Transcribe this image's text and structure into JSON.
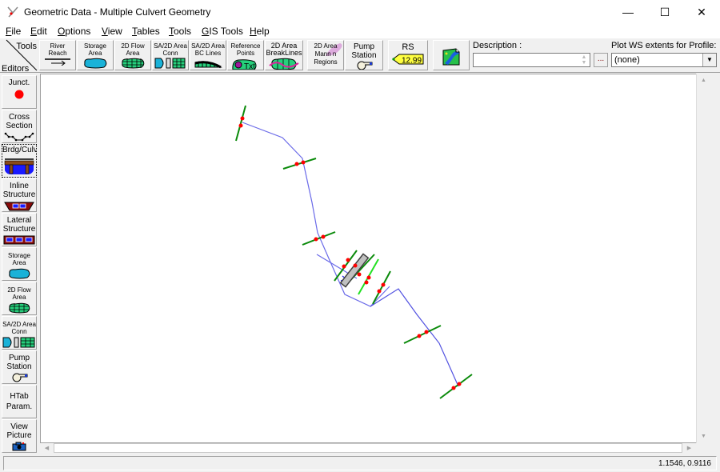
{
  "window": {
    "title": "Geometric Data - Multiple Culvert Geometry",
    "minimize": "—",
    "maximize": "☐",
    "close": "✕"
  },
  "menu": [
    "File",
    "Edit",
    "Options",
    "View",
    "Tables",
    "Tools",
    "GIS Tools",
    "Help"
  ],
  "menu_mnemonics": [
    "F",
    "E",
    "O",
    "V",
    "T",
    "T",
    "G",
    "H"
  ],
  "corner": {
    "tools": "Tools",
    "editors": "Editors"
  },
  "toolbar": [
    {
      "name": "river-reach",
      "label": "River\nReach",
      "icon": "arrow-right-icon"
    },
    {
      "name": "storage-area",
      "label": "Storage\nArea",
      "icon": "storage-area-icon"
    },
    {
      "name": "2d-flow-area",
      "label": "2D Flow\nArea",
      "icon": "2d-grid-icon"
    },
    {
      "name": "sa-2d-area-conn",
      "label": "SA/2D Area\nConn",
      "icon": "sa-conn-icon"
    },
    {
      "name": "sa-2d-area-bc-lines",
      "label": "SA/2D Area\nBC Lines",
      "icon": "bc-lines-icon"
    },
    {
      "name": "reference-points",
      "label": "Reference\nPoints",
      "icon": "reference-points-icon"
    },
    {
      "name": "2d-area-breaklines",
      "label": "2D Area\nBreakLines",
      "icon": "breaklines-icon"
    },
    {
      "name": "2d-area-mann-n-regions",
      "label": "2D Area\nMann n\nRegions",
      "icon": "mann-n-icon"
    },
    {
      "name": "pump-station",
      "label": "Pump\nStation",
      "icon": "pump-icon"
    },
    {
      "name": "rs",
      "label": "RS",
      "rs_value": "12.99",
      "icon": "rs-tag-icon"
    },
    {
      "name": "background-map",
      "label": "",
      "icon": "map-layer-icon"
    }
  ],
  "description": {
    "label": "Description :",
    "value": "",
    "more": "..."
  },
  "profile": {
    "label": "Plot WS extents for Profile:",
    "value": "(none)"
  },
  "editors": [
    {
      "name": "junction",
      "label": "Junct.",
      "icon": "junction-dot-icon"
    },
    {
      "name": "cross-section",
      "label": "Cross\nSection",
      "icon": "cross-section-icon"
    },
    {
      "name": "bridge-culvert",
      "label": "Brdg/Culv",
      "icon": "bridge-culvert-icon",
      "selected": true
    },
    {
      "name": "inline-structure",
      "label": "Inline\nStructure",
      "icon": "inline-structure-icon"
    },
    {
      "name": "lateral-structure",
      "label": "Lateral\nStructure",
      "icon": "lateral-structure-icon"
    },
    {
      "name": "storage-area",
      "label": "Storage\nArea",
      "icon": "storage-area-icon"
    },
    {
      "name": "2d-flow-area",
      "label": "2D Flow\nArea",
      "icon": "2d-grid-icon"
    },
    {
      "name": "sa-2d-area-conn",
      "label": "SA/2D Area\nConn",
      "icon": "sa-conn-icon"
    },
    {
      "name": "pump-station",
      "label": "Pump\nStation",
      "icon": "pump-icon"
    },
    {
      "name": "htab-param",
      "label": "HTab\nParam.",
      "icon": ""
    },
    {
      "name": "view-picture",
      "label": "View\nPicture",
      "icon": "camera-icon"
    }
  ],
  "status": {
    "coordinates": "1.1546, 0.9116"
  },
  "colors": {
    "reach": "#3a3ad8",
    "cross_section": "#0a8a0a",
    "cross_section_bright": "#22e022",
    "bank_point": "#ff0000",
    "structure_fill": "#c0c0c0"
  }
}
